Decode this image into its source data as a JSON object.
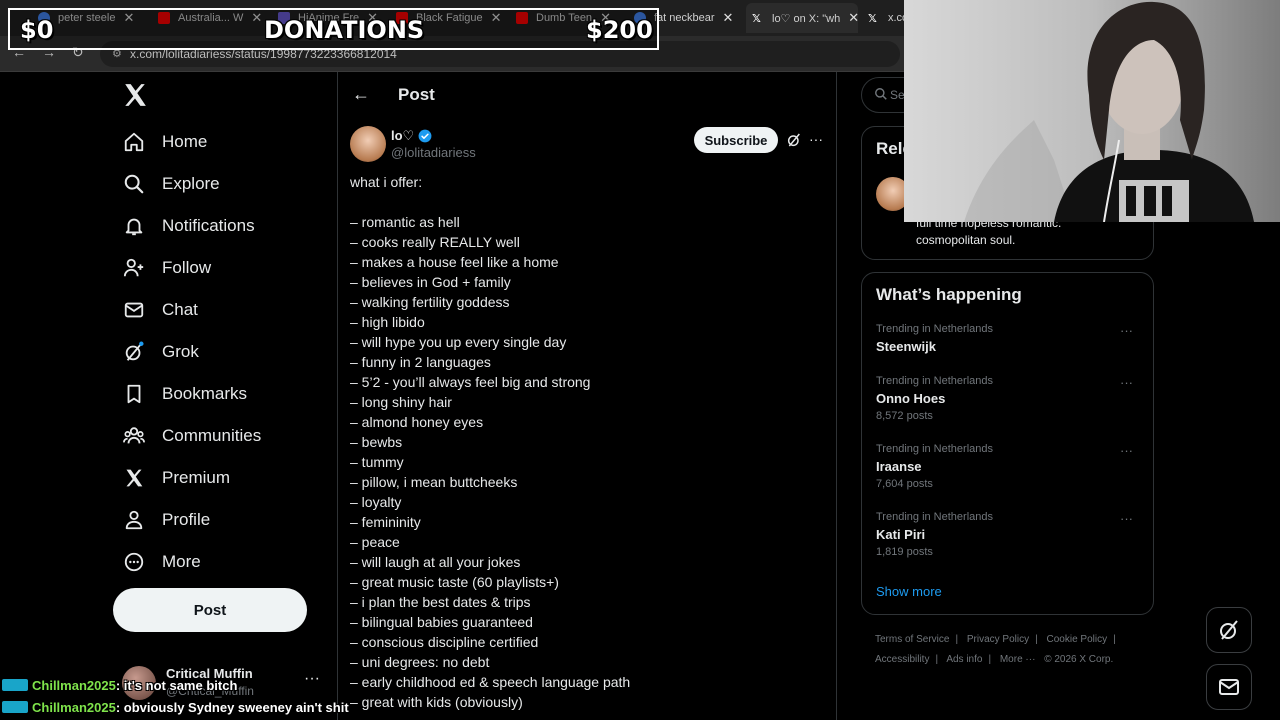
{
  "browser": {
    "tabs": [
      {
        "title": "peter steele",
        "fav": "#4285f4"
      },
      {
        "title": "Australia... W",
        "fav": "#ff0000"
      },
      {
        "title": "HiAnime Fre",
        "fav": "#6b5bd6"
      },
      {
        "title": "Black Fatigue",
        "fav": "#ff0000"
      },
      {
        "title": "Dumb Teen",
        "fav": "#ff0000"
      },
      {
        "title": "fat neckbear",
        "fav": "#4285f4"
      },
      {
        "title": "lo♡ on X: \"wh",
        "fav": "#ffffff"
      },
      {
        "title": "x.co",
        "fav": "#ffffff"
      }
    ],
    "url": "x.com/lolitadiariess/status/1998773223366812014"
  },
  "overlay": {
    "donation_left": "$0",
    "donation_title": "DONATIONS",
    "donation_right": "$200"
  },
  "sidebar": {
    "items": [
      {
        "label": "Home",
        "icon": "home-icon"
      },
      {
        "label": "Explore",
        "icon": "search-icon"
      },
      {
        "label": "Notifications",
        "icon": "bell-icon"
      },
      {
        "label": "Follow",
        "icon": "person-add-icon"
      },
      {
        "label": "Chat",
        "icon": "mail-icon"
      },
      {
        "label": "Grok",
        "icon": "grok-icon"
      },
      {
        "label": "Bookmarks",
        "icon": "bookmark-icon"
      },
      {
        "label": "Communities",
        "icon": "people-icon"
      },
      {
        "label": "Premium",
        "icon": "x-icon"
      },
      {
        "label": "Profile",
        "icon": "person-icon"
      },
      {
        "label": "More",
        "icon": "more-circle-icon"
      }
    ],
    "post_label": "Post",
    "account": {
      "name": "Critical Muffin",
      "handle": "@Critical_Muffin"
    }
  },
  "main": {
    "title": "Post",
    "author": {
      "name": "lo♡",
      "handle": "@lolitadiariess"
    },
    "subscribe_label": "Subscribe",
    "lines": [
      "what i offer:",
      "",
      "– romantic as hell",
      "– cooks really REALLY well",
      "– makes a house feel like a home",
      "– believes in God + family",
      "– walking fertility goddess",
      "– high libido",
      "– will hype you up every single day",
      "– funny in 2 languages",
      "– 5’2 - you’ll always feel big and strong",
      "– long shiny hair",
      "– almond honey eyes",
      "– bewbs",
      "– tummy",
      "– pillow, i mean buttcheeks",
      "– loyalty",
      "– femininity",
      "– peace",
      "– will laugh at all your jokes",
      "– great music taste (60 playlists+)",
      "– i plan the best dates & trips",
      "– bilingual babies guaranteed",
      "– conscious discipline certified",
      "– uni degrees: no debt",
      "– early childhood ed & speech language path",
      "– great with kids (obviously)"
    ]
  },
  "right": {
    "search_placeholder": "Se",
    "relevant": {
      "title": "Rele",
      "bio_line1": "full time hopeless romantic.",
      "bio_line2": "cosmopolitan soul."
    },
    "happening_title": "What’s happening",
    "trends": [
      {
        "context": "Trending in Netherlands",
        "name": "Steenwijk",
        "posts": ""
      },
      {
        "context": "Trending in Netherlands",
        "name": "Onno Hoes",
        "posts": "8,572 posts"
      },
      {
        "context": "Trending in Netherlands",
        "name": "Iraanse",
        "posts": "7,604 posts"
      },
      {
        "context": "Trending in Netherlands",
        "name": "Kati Piri",
        "posts": "1,819 posts"
      }
    ],
    "show_more": "Show more",
    "footer": {
      "terms": "Terms of Service",
      "privacy": "Privacy Policy",
      "cookie": "Cookie Policy",
      "accessibility": "Accessibility",
      "ads": "Ads info",
      "more": "More ···",
      "copyright": "© 2026 X Corp."
    }
  },
  "chat": [
    {
      "user": "Chillman2025",
      "message": ": it's not same bitch"
    },
    {
      "user": "Chillman2025",
      "message": ": obviously Sydney sweeney ain't shit"
    }
  ],
  "colors": {
    "accent": "#1d9bf0",
    "background": "#000000",
    "chat_user": "#7fe34b"
  }
}
